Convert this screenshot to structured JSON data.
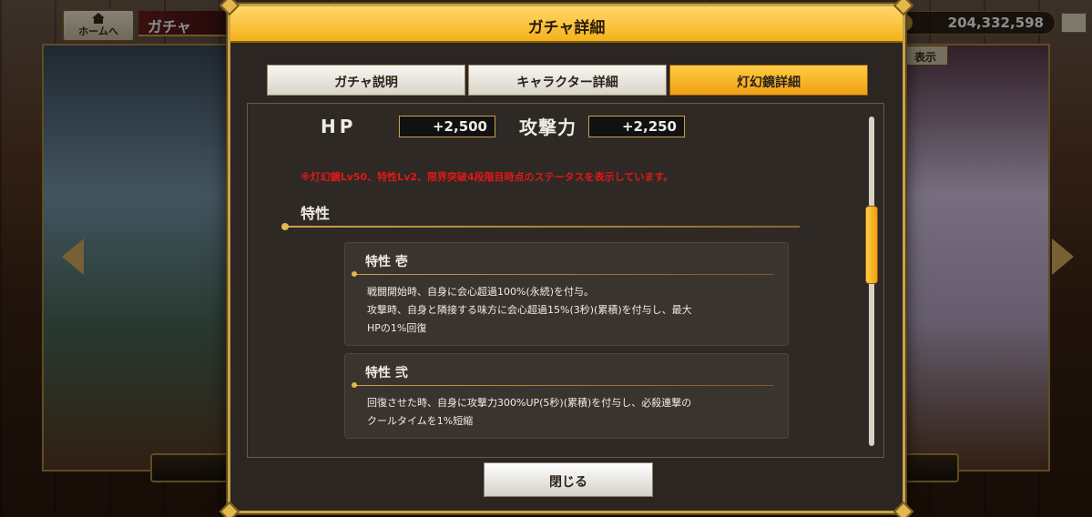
{
  "top_bar": {
    "home_label": "ホームへ",
    "gacha_label": "ガチャ",
    "currency_amount": "204,332,598",
    "display_label": "表示"
  },
  "modal": {
    "title": "ガチャ詳細",
    "tabs": [
      {
        "label": "ガチャ説明",
        "active": false
      },
      {
        "label": "キャラクター詳細",
        "active": false
      },
      {
        "label": "灯幻鏡詳細",
        "active": true
      }
    ],
    "stats": {
      "hp_label": "HP",
      "hp_value": "+2,500",
      "attack_label": "攻撃力",
      "attack_value": "+2,250"
    },
    "note": "※灯幻鏡Lv50、特性Lv2、限界突破4段階目時点のステータスを表示しています。",
    "section_title": "特性",
    "traits": [
      {
        "title": "特性 壱",
        "lines": [
          "戦闘開始時、自身に会心超過100%(永続)を付与。",
          "攻撃時、自身と隣接する味方に会心超過15%(3秒)(累積)を付与し、最大",
          "HPの1%回復"
        ]
      },
      {
        "title": "特性 弐",
        "lines": [
          "回復させた時、自身に攻撃力300%UP(5秒)(累積)を付与し、必殺連撃の",
          "クールタイムを1%短縮"
        ]
      }
    ],
    "close_label": "閉じる"
  },
  "colors": {
    "accent": "#f4b21a",
    "frame_gold": "#c9a24a",
    "panel_bg": "#2b2622",
    "note_red": "#e01818"
  }
}
